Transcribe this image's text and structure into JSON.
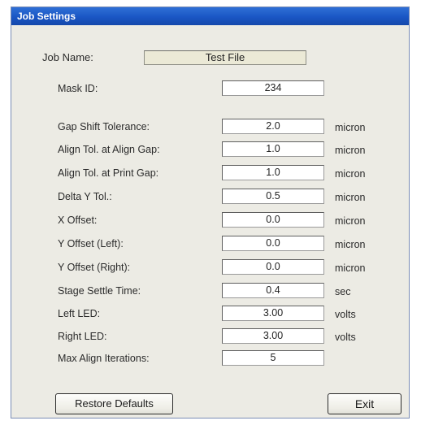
{
  "window": {
    "title": "Job Settings"
  },
  "job": {
    "label": "Job Name:",
    "value": "Test File"
  },
  "fields": [
    {
      "label": "Mask ID:",
      "value": "234",
      "unit": ""
    },
    {
      "label": "Gap Shift Tolerance:",
      "value": "2.0",
      "unit": "micron"
    },
    {
      "label": "Align Tol. at Align Gap:",
      "value": "1.0",
      "unit": "micron"
    },
    {
      "label": "Align Tol. at Print Gap:",
      "value": "1.0",
      "unit": "micron"
    },
    {
      "label": "Delta Y Tol.:",
      "value": "0.5",
      "unit": "micron"
    },
    {
      "label": "X Offset:",
      "value": "0.0",
      "unit": "micron"
    },
    {
      "label": "Y Offset (Left):",
      "value": "0.0",
      "unit": "micron"
    },
    {
      "label": "Y Offset (Right):",
      "value": "0.0",
      "unit": "micron"
    },
    {
      "label": "Stage Settle Time:",
      "value": "0.4",
      "unit": "sec"
    },
    {
      "label": "Left LED:",
      "value": "3.00",
      "unit": "volts"
    },
    {
      "label": "Right LED:",
      "value": "3.00",
      "unit": "volts"
    },
    {
      "label": "Max Align Iterations:",
      "value": "5",
      "unit": ""
    }
  ],
  "buttons": {
    "restore_defaults": "Restore Defaults",
    "exit": "Exit"
  }
}
